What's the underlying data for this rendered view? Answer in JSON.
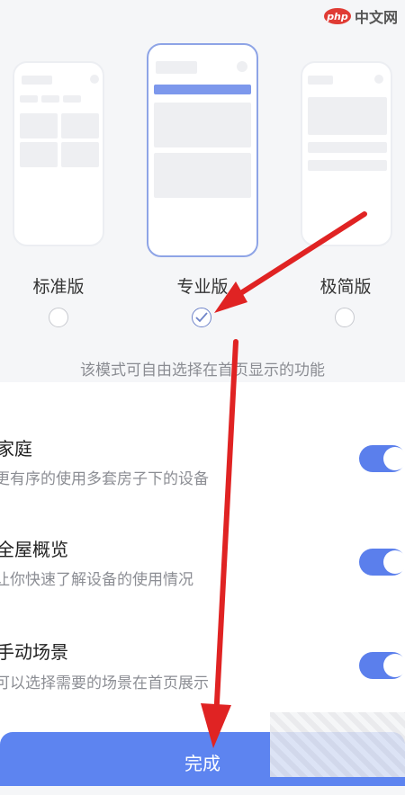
{
  "watermark": {
    "badge": "php",
    "text": "中文网"
  },
  "modes": [
    {
      "label": "标准版",
      "selected": false
    },
    {
      "label": "专业版",
      "selected": true
    },
    {
      "label": "极简版",
      "selected": false
    }
  ],
  "description": "该模式可自由选择在首页显示的功能",
  "settings": [
    {
      "title": "家庭",
      "subtitle": "更有序的使用多套房子下的设备",
      "enabled": true
    },
    {
      "title": "全屋概览",
      "subtitle": "让你快速了解设备的使用情况",
      "enabled": true
    },
    {
      "title": "手动场景",
      "subtitle": "可以选择需要的场景在首页展示",
      "enabled": true
    }
  ],
  "done_label": "完成",
  "colors": {
    "accent": "#5b7fec",
    "arrow": "#e02323"
  }
}
